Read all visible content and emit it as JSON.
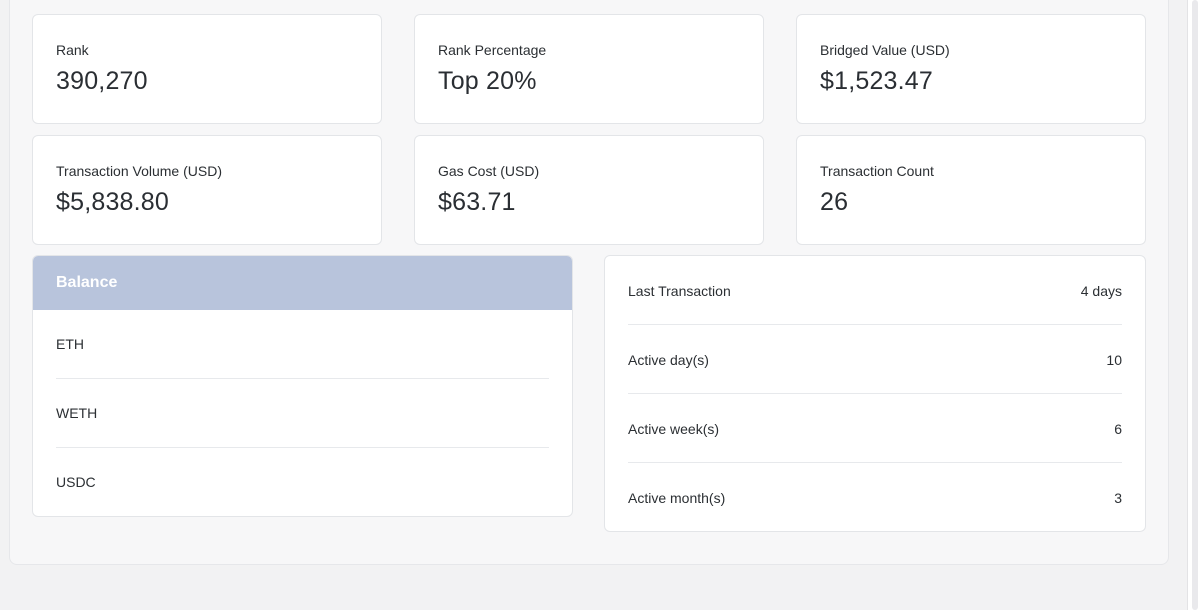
{
  "stats": [
    {
      "label": "Rank",
      "value": "390,270"
    },
    {
      "label": "Rank Percentage",
      "value": "Top 20%"
    },
    {
      "label": "Bridged Value (USD)",
      "value": "$1,523.47"
    },
    {
      "label": "Transaction Volume (USD)",
      "value": "$5,838.80"
    },
    {
      "label": "Gas Cost (USD)",
      "value": "$63.71"
    },
    {
      "label": "Transaction Count",
      "value": "26"
    }
  ],
  "balance": {
    "title": "Balance",
    "tokens": [
      "ETH",
      "WETH",
      "USDC"
    ]
  },
  "activity": [
    {
      "label": "Last Transaction",
      "value": "4 days"
    },
    {
      "label": "Active day(s)",
      "value": "10"
    },
    {
      "label": "Active week(s)",
      "value": "6"
    },
    {
      "label": "Active month(s)",
      "value": "3"
    }
  ],
  "colors": {
    "balance_header": "#b8c4dc",
    "card_background": "#ffffff",
    "page_background": "#f2f2f3"
  }
}
